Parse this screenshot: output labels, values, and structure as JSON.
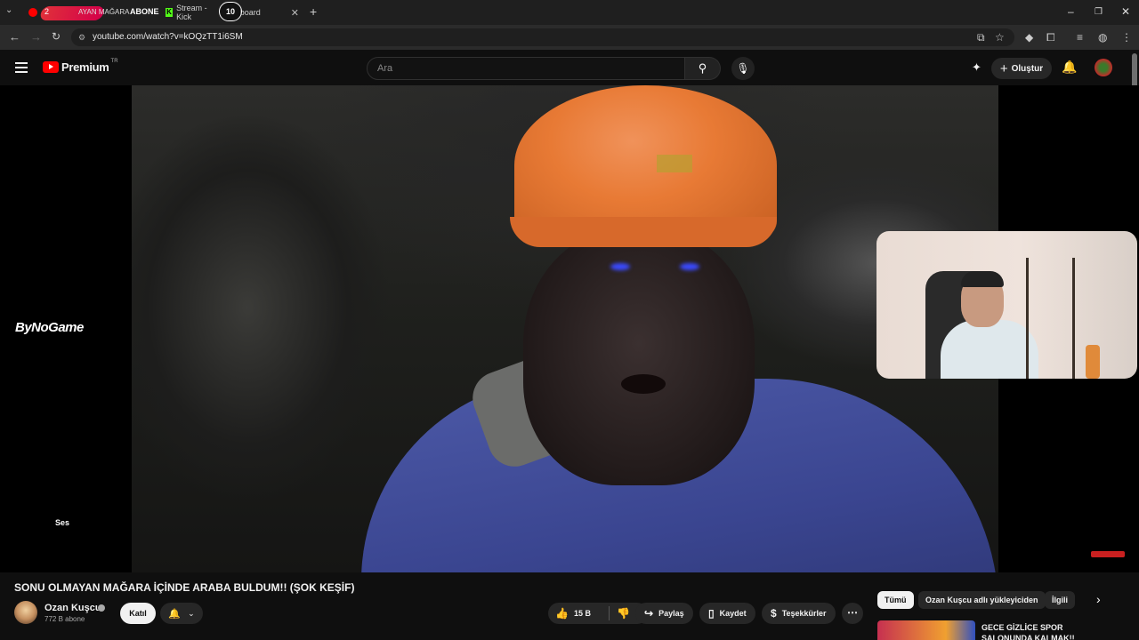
{
  "tabs": [
    {
      "badge": "2",
      "title": "AYAN MAĞARA",
      "overlay": "ABONE"
    },
    {
      "title": "Stream - Kick",
      "suffix": "board"
    }
  ],
  "timer": "10",
  "url": "youtube.com/watch?v=kOQzTT1i6SM",
  "header": {
    "brand": "Premium",
    "region": "TR",
    "search_placeholder": "Ara",
    "create_label": "Oluştur"
  },
  "player": {
    "sponsor_logo": "ByNoGame",
    "side_label": "Ses"
  },
  "video": {
    "title": "SONU OLMAYAN MAĞARA İÇİNDE ARABA BULDUM!! (ŞOK KEŞİF)",
    "channel": "Ozan Kuşcu",
    "subscribers": "772 B abone",
    "join_label": "Katıl",
    "likes": "15 B",
    "share_label": "Paylaş",
    "save_label": "Kaydet",
    "thanks_label": "Teşekkürler"
  },
  "chips": [
    "Tümü",
    "Ozan Kuşcu adlı yükleyiciden",
    "İlgili"
  ],
  "recommended": [
    {
      "title": "GECE GİZLİCE SPOR SALONUNDA KALMAK!!"
    }
  ],
  "icons": {
    "like": "thumbs-up-icon",
    "dislike": "thumbs-down-icon",
    "share": "share-icon",
    "save": "bookmark-icon",
    "thanks": "thanks-icon",
    "bell": "bell-icon"
  },
  "colors": {
    "accent": "#ff0000",
    "background": "#0f0f0f",
    "chip_bg": "#272727",
    "kick": "#53fc18"
  }
}
